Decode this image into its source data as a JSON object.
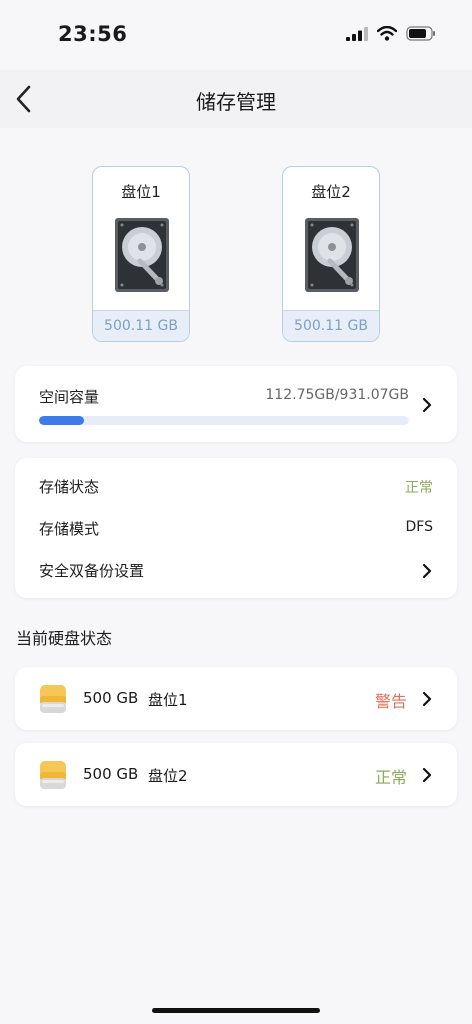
{
  "status_bar": {
    "time": "23:56"
  },
  "header": {
    "title": "储存管理"
  },
  "slots": [
    {
      "name": "盘位1",
      "capacity": "500.11 GB"
    },
    {
      "name": "盘位2",
      "capacity": "500.11 GB"
    }
  ],
  "space": {
    "label": "空间容量",
    "value": "112.75GB/931.07GB",
    "usage_fraction": 0.121
  },
  "storage": {
    "status_label": "存储状态",
    "status_value": "正常",
    "mode_label": "存储模式",
    "mode_value": "DFS",
    "backup_label": "安全双备份设置"
  },
  "disks_section": {
    "title": "当前硬盘状态",
    "items": [
      {
        "size": "500 GB",
        "slot": "盘位1",
        "status": "警告"
      },
      {
        "size": "500 GB",
        "slot": "盘位2",
        "status": "正常"
      }
    ]
  },
  "colors": {
    "accent": "#3e7bea",
    "ok": "#8aab57",
    "warn": "#e0705c",
    "slot_caption": "#7f9fc4"
  }
}
